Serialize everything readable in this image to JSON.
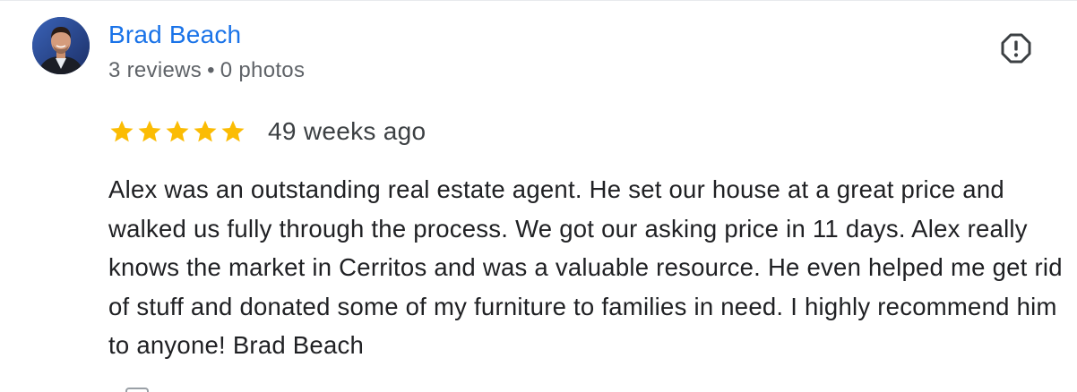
{
  "review": {
    "author_name": "Brad Beach",
    "reviews_count": "3 reviews",
    "separator": "•",
    "photos_count": "0 photos",
    "rating": 5,
    "rating_max": 5,
    "time_ago": "49 weeks ago",
    "text": "Alex was an outstanding real estate agent. He set our house at a great price and walked us fully through the process. We got our asking price in 11 days. Alex really knows the market in Cerritos and was a valuable resource. He even helped me get rid of stuff and donated some of my furniture to families in need. I highly recommend him to anyone! Brad Beach"
  },
  "icons": {
    "report": "report-icon",
    "star": "star-icon"
  },
  "colors": {
    "author_link": "#1a73e8",
    "star": "#fbbc04",
    "meta_text": "#5f6368",
    "body_text": "#202124"
  }
}
